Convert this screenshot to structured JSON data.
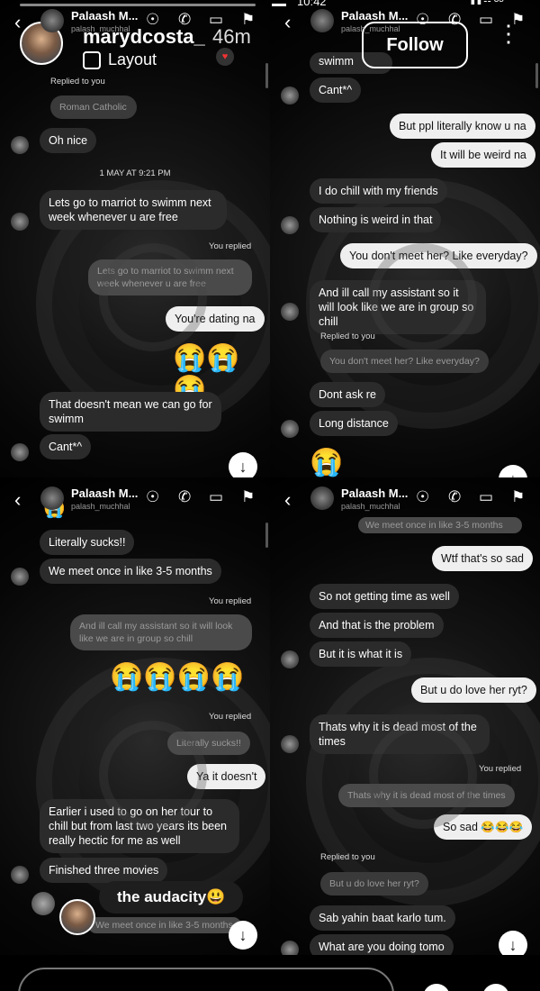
{
  "story_overlay": {
    "username": "marydcosta_",
    "time": "46m",
    "layout_label": "Layout",
    "follow_label": "Follow",
    "clock": "10:42",
    "battery": "35",
    "reaction": "the audacity😃"
  },
  "panels": [
    {
      "header": {
        "name": "Palaash M...",
        "handle": "palash_muchhal"
      },
      "items": [
        {
          "kind": "meta",
          "text": "Replied to you"
        },
        {
          "kind": "quote_in",
          "text": "Roman Catholic"
        },
        {
          "kind": "in",
          "text": "Oh nice"
        },
        {
          "kind": "time",
          "text": "1 MAY AT 9:21 PM"
        },
        {
          "kind": "in",
          "text": "Lets go to marriot to swimm next week whenever u are free"
        },
        {
          "kind": "meta",
          "text": "You replied"
        },
        {
          "kind": "quote_out",
          "text": "Lets go to marriot to swimm next week whenever u are free"
        },
        {
          "kind": "out",
          "text": "You're dating na"
        },
        {
          "kind": "emoji",
          "text": "😭😭😭"
        },
        {
          "kind": "in",
          "text": "That doesn't mean we can go for swimm"
        },
        {
          "kind": "in",
          "text": "Cant*^"
        }
      ]
    },
    {
      "header": {
        "name": "Palaash M...",
        "handle": "palash_muchhal"
      },
      "items": [
        {
          "kind": "in",
          "text": "swimm"
        },
        {
          "kind": "in",
          "text": "Cant*^"
        },
        {
          "kind": "out",
          "text": "But ppl literally know u na"
        },
        {
          "kind": "out",
          "text": "It will be weird na"
        },
        {
          "kind": "in",
          "text": "I do chill with my friends"
        },
        {
          "kind": "in",
          "text": "Nothing is weird in that"
        },
        {
          "kind": "out",
          "text": "You don't meet her? Like everyday?"
        },
        {
          "kind": "in",
          "text": "And ill call my assistant so it will look like we are in group so chill"
        },
        {
          "kind": "meta",
          "text": "Replied to you"
        },
        {
          "kind": "quote_in",
          "text": "You don't meet her? Like everyday?"
        },
        {
          "kind": "in",
          "text": "Dont ask re"
        },
        {
          "kind": "in",
          "text": "Long distance"
        },
        {
          "kind": "emoji",
          "text": "😭"
        }
      ]
    },
    {
      "header": {
        "name": "Palaash M...",
        "handle": "palash_muchhal"
      },
      "items": [
        {
          "kind": "emoji",
          "text": "😭"
        },
        {
          "kind": "in",
          "text": "Literally sucks!!"
        },
        {
          "kind": "in",
          "text": "We meet  once in like 3-5 months"
        },
        {
          "kind": "meta",
          "text": "You replied"
        },
        {
          "kind": "quote_out",
          "text": "And ill call my assistant so it will look like we are in group so chill"
        },
        {
          "kind": "emoji",
          "text": "😭😭😭😭"
        },
        {
          "kind": "meta",
          "text": "You replied"
        },
        {
          "kind": "quote_out",
          "text": "Literally sucks!!"
        },
        {
          "kind": "out",
          "text": "Ya it doesn't"
        },
        {
          "kind": "in",
          "text": "Earlier i used to go on her tour to chill but from last two years its been really hectic for me as well"
        },
        {
          "kind": "in",
          "text": "Finished three movies"
        },
        {
          "kind": "quote_out",
          "text": "We meet  once in like 3-5 months"
        }
      ]
    },
    {
      "header": {
        "name": "Palaash M...",
        "handle": "palash_muchhal"
      },
      "items": [
        {
          "kind": "quote_out",
          "text": "We meet  once in like 3-5 months"
        },
        {
          "kind": "out",
          "text": "Wtf that's so sad"
        },
        {
          "kind": "in",
          "text": "So not getting time as well"
        },
        {
          "kind": "in",
          "text": "And that is the problem"
        },
        {
          "kind": "in",
          "text": "But it is what it is"
        },
        {
          "kind": "out",
          "text": "But u do love her ryt?"
        },
        {
          "kind": "in",
          "text": "Thats why it is dead most of the times"
        },
        {
          "kind": "meta",
          "text": "You replied"
        },
        {
          "kind": "quote_out",
          "text": "Thats why it is dead most of the times"
        },
        {
          "kind": "out",
          "text": "So sad 😂😂😂"
        },
        {
          "kind": "meta",
          "text": "Replied to you"
        },
        {
          "kind": "quote_in",
          "text": "But u do love her ryt?"
        },
        {
          "kind": "in",
          "text": "Sab yahin baat karlo tum."
        },
        {
          "kind": "in",
          "text": "What are you doing tomo"
        }
      ]
    }
  ]
}
